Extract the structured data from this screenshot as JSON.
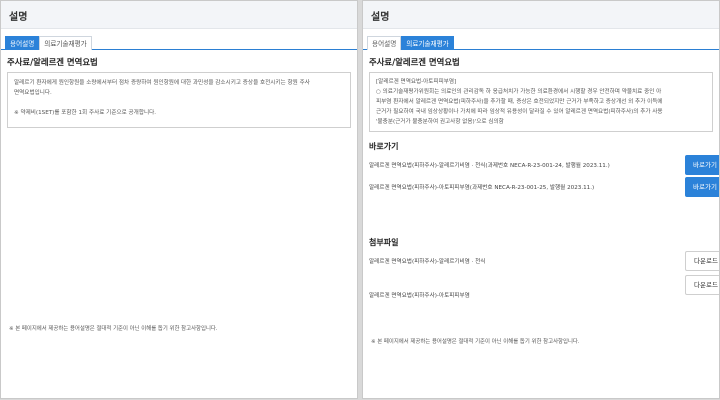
{
  "left": {
    "title": "설명",
    "tabs": [
      {
        "label": "용어설명"
      },
      {
        "label": "의료기술재평가"
      }
    ],
    "section_title": "주사료/알레르겐 면역요법",
    "box_lines": [
      "알레르기 환자에게 원인항원을 소량에서부터 점차 증량하여 원인항원에 대한 과민성을 감소시키고 증상을 호전시키는 항원 주사",
      "면역요법입니다.",
      "",
      "※ 약제비(1SET)를 포함한 1회 주사료 기준으로 공개합니다."
    ],
    "footnote": "※ 본 페이지에서 제공하는 용어설명은 절대적 기준이 아닌 이해를 돕기 위한 참고사항입니다."
  },
  "right": {
    "title": "설명",
    "tabs": [
      {
        "label": "용어설명"
      },
      {
        "label": "의료기술재평가"
      }
    ],
    "section_title": "주사료/알레르겐 면역요법",
    "box_lines": [
      "[알레르겐 면역요법-아토피피부염]",
      "○ 의료기술재평가위원회는 의료인의 관리감독 하 응급처치가 가능한 의료환경에서 시행할 경우 안전하며 약물치료 중인 아",
      "피부염 환자에서 알레르겐 면역요법(피하주사)을 추가할 때, 증상은 호전되었지만 근거가 부족하고 증상개선 외 추가 이득에",
      "근거가 필요하여 국내 임상상황이나 가치에 따라 임상적 유용성이 달라질 수 있어 알레르겐 면역요법(피하주사)의 추가 사용",
      "'불충분(근거가 불충분하여 권고사항 없음)'으로 심의함"
    ],
    "shortcut_title": "바로가기",
    "shortcuts": [
      {
        "text": "알레르겐 면역요법(피하주사)-알레르기비염 · 천식(과제번호 NECA-R-23-001-24, 발행월 2023.11.)",
        "button": "바로가기"
      },
      {
        "text": "알레르겐 면역요법(피하주사)-아토피피부염(과제번호 NECA-R-23-001-25, 발행월 2023.11.)",
        "button": "바로가기"
      }
    ],
    "attach_title": "첨부파일",
    "attachments": [
      {
        "text": "알레르겐 면역요법(피하주사)-알레르기비염 · 천식",
        "button": "다운로드"
      },
      {
        "text": "알레르겐 면역요법(피하주사)-아토피피부염",
        "button": "다운로드"
      }
    ],
    "footnote": "※ 본 페이지에서 제공하는 용어설명은 절대적 기준이 아닌 이해를 돕기 위한 참고사항입니다."
  }
}
